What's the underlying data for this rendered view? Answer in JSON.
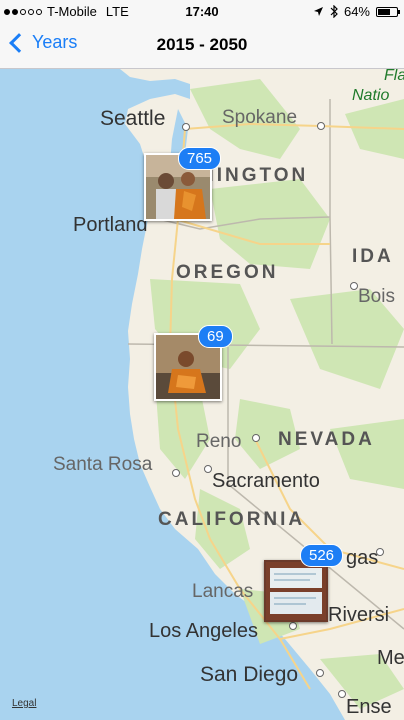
{
  "status_bar": {
    "carrier": "T-Mobile",
    "network": "LTE",
    "time": "17:40",
    "battery": "64%",
    "battery_level": 0.64,
    "signal_bars": 2,
    "icons": [
      "location-arrow-icon",
      "bluetooth-icon",
      "battery-icon"
    ]
  },
  "nav": {
    "back_label": "Years",
    "title": "2015 - 2050"
  },
  "map": {
    "cities": {
      "seattle": "Seattle",
      "spokane": "Spokane",
      "portland": "Portland",
      "boise": "Bois",
      "reno": "Reno",
      "santa_rosa": "Santa Rosa",
      "sacramento": "Sacramento",
      "las_vegas": "gas",
      "lancaster": "Lancas",
      "los_angeles": "Los Angeles",
      "riverside": "Riversi",
      "san_diego": "San Diego",
      "ensenada": "Ense",
      "mexicali": "Me"
    },
    "states": {
      "washington": "HINGTON",
      "oregon": "OREGON",
      "idaho": "IDA",
      "nevada": "NEVADA",
      "california": "CALIFORNIA"
    },
    "national_forest": {
      "line1": "Fla",
      "line2": "Natio"
    },
    "clusters": [
      {
        "count": "765"
      },
      {
        "count": "69"
      },
      {
        "count": "526"
      }
    ],
    "legal": "Legal",
    "colors": {
      "water": "#a9d3ef",
      "land": "#f3efe4",
      "green": "#cfe6b4",
      "badge": "#1d7ef5"
    }
  }
}
